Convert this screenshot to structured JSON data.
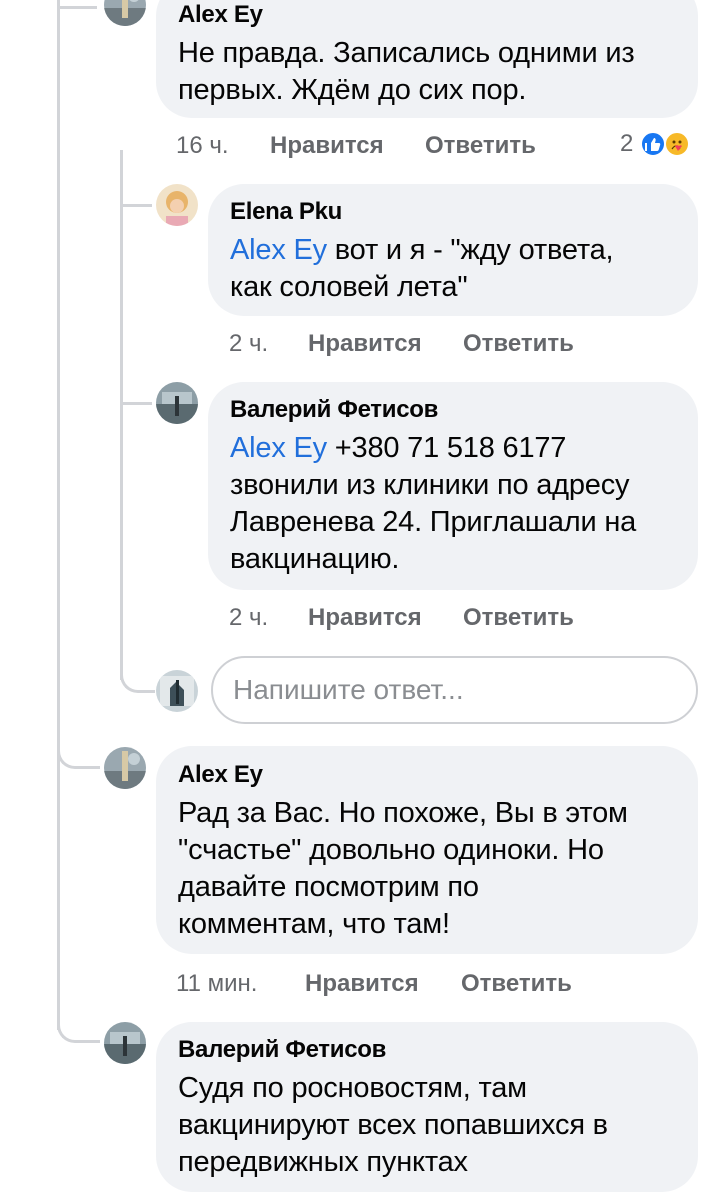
{
  "comments": [
    {
      "author": "Alex Ey",
      "mention": "",
      "text_lines": [
        "Не правда. Записались одними из",
        "первых. Ждём до сих пор."
      ],
      "time": "16 ч.",
      "like_label": "Нравится",
      "reply_label": "Ответить",
      "reaction_count": "2",
      "reactions": [
        "like-icon",
        "care-icon"
      ]
    },
    {
      "author": "Elena Pku",
      "mention": "Alex Ey",
      "text_lines": [
        " вот и я - \"жду ответа,",
        "как соловей лета\""
      ],
      "time": "2 ч.",
      "like_label": "Нравится",
      "reply_label": "Ответить"
    },
    {
      "author": "Валерий Фетисов",
      "mention": "Alex Ey",
      "text_lines": [
        " +380 71 518 6177",
        "звонили из клиники по адресу",
        "Лавренева 24. Приглашали на",
        "вакцинацию."
      ],
      "time": "2 ч.",
      "like_label": "Нравится",
      "reply_label": "Ответить"
    },
    {
      "author": "Alex Ey",
      "mention": "",
      "text_lines": [
        "Рад за Вас. Но похоже, Вы в этом",
        "\"счастье\" довольно одиноки. Но",
        "давайте посмотрим по",
        "комментам, что там!"
      ],
      "time": "11 мин.",
      "like_label": "Нравится",
      "reply_label": "Ответить"
    },
    {
      "author": "Валерий Фетисов",
      "mention": "",
      "text_lines": [
        "Судя по росновостям, там",
        "вакцинируют всех попавшихся в",
        "передвижных пунктах"
      ]
    }
  ],
  "reply_input": {
    "placeholder": "Напишите ответ..."
  },
  "colors": {
    "bubble": "#f0f2f5",
    "mention": "#216fdb",
    "meta": "#65676b",
    "like_blue": "#1877f2",
    "care_yellow": "#f7b928"
  }
}
